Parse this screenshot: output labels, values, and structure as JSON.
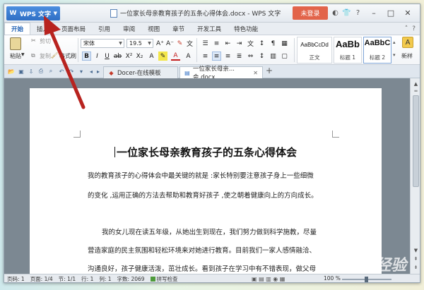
{
  "app": {
    "menu_button_label": "WPS 文字",
    "document_title": "一位家长母亲教育孩子的五条心得体会.docx - WPS 文字",
    "login_label": "未登录"
  },
  "menu_tabs": [
    "开始",
    "插入",
    "页面布局",
    "引用",
    "审阅",
    "视图",
    "章节",
    "开发工具",
    "特色功能"
  ],
  "ribbon": {
    "paste_label": "粘贴",
    "cut_label": "剪切",
    "copy_label": "复制",
    "format_painter_label": "格式刷",
    "font_name": "宋体",
    "font_size": "19.5",
    "styles": [
      {
        "sample": "AaBbCcDd",
        "name": "正文"
      },
      {
        "sample": "AaBb",
        "name": "标题 1"
      },
      {
        "sample": "AaBbC",
        "name": "标题 2"
      }
    ],
    "new_style_label": "新样"
  },
  "doc_tabs": [
    {
      "label": "Docer-在线模板"
    },
    {
      "label": "一位家长母亲...会.docx"
    }
  ],
  "document": {
    "heading": "一位家长母亲教育孩子的五条心得体会",
    "paragraphs": [
      "我的教育孩子的心得体会中最关键的就是 :家长特别要注意孩子身上一些细微",
      "的变化 ,运用正确的方法去帮助和教育好孩子 ,使之朝着健康向上的方向成长。",
      "我的女儿现在读五年级，从她出生到现在，我们努力做到科学施教，尽量",
      "营造家庭的民主氛围和轻松环境来对她进行教育。目前我们一家人感情融洽、",
      "沟通良好，孩子健康活泼，茁壮成长。看到孩子在学习中有不错表现，做父母"
    ]
  },
  "status": {
    "page_num": "页码: 1",
    "pages": "页面: 1/4",
    "section": "节: 1/1",
    "row": "行: 1",
    "col": "列: 1",
    "word_count": "字数: 2069",
    "spell_check": "拼写检查",
    "zoom": "100 %"
  },
  "watermark": "Baidu经验",
  "colors": {
    "wps_blue": "#2f6fc4",
    "login_red": "#e2644a",
    "arrow_red": "#b8231f"
  }
}
